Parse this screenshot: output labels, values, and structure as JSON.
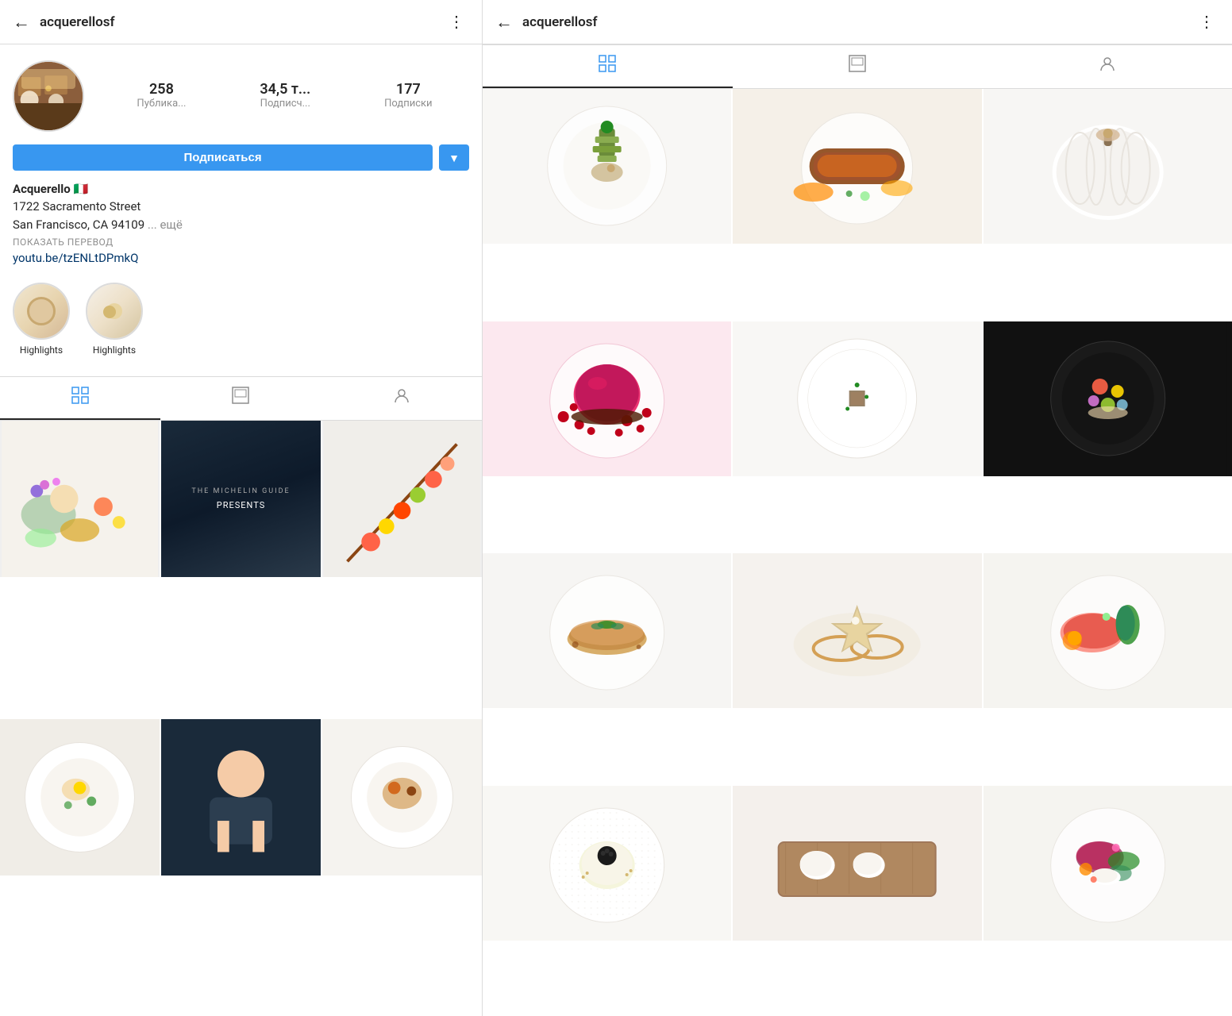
{
  "left": {
    "header": {
      "back_label": "←",
      "username": "acquerellosf",
      "more_label": "⋮"
    },
    "profile": {
      "stats": [
        {
          "number": "258",
          "label": "Публика..."
        },
        {
          "number": "34,5 т...",
          "label": "Подписч..."
        },
        {
          "number": "177",
          "label": "Подписки"
        }
      ],
      "subscribe_btn": "Подписаться",
      "dropdown_btn": "▼",
      "name": "Acquerello 🇮🇹",
      "address_line1": "1722 Sacramento Street",
      "address_line2": "San Francisco, CA 94109",
      "address_more": "... ещё",
      "translate_label": "ПОКАЗАТЬ ПЕРЕВОД",
      "link": "youtu.be/tzENLtDPmkQ",
      "highlights": [
        {
          "label": "Highlights"
        },
        {
          "label": "Highlights"
        }
      ]
    },
    "tabs": [
      {
        "icon": "⊞",
        "label": "grid",
        "active": true
      },
      {
        "icon": "⬜",
        "label": "feed",
        "active": false
      },
      {
        "icon": "☺",
        "label": "tagged",
        "active": false
      }
    ],
    "grid_posts": [
      {
        "bg": "food-1"
      },
      {
        "bg": "michelin-dark",
        "text": "THE MICHELIN GUIDE PRESENTS"
      },
      {
        "bg": "food-3"
      },
      {
        "bg": "food-4"
      },
      {
        "bg": "food-5"
      }
    ]
  },
  "right": {
    "header": {
      "back_label": "←",
      "username": "acquerellosf",
      "more_label": "⋮"
    },
    "tabs": [
      {
        "icon": "⊞",
        "label": "grid",
        "active": true
      },
      {
        "icon": "⬜",
        "label": "feed",
        "active": false
      },
      {
        "icon": "☺",
        "label": "tagged",
        "active": false
      }
    ],
    "grid_rows": [
      [
        {
          "bg": "rfood-1",
          "type": "green-garnish"
        },
        {
          "bg": "rfood-2",
          "type": "meat"
        },
        {
          "bg": "rfood-3",
          "type": "white-pumpkin"
        }
      ],
      [
        {
          "bg": "dessert-plate",
          "type": "dessert"
        },
        {
          "bg": "rfood-5",
          "type": "plain-plate"
        },
        {
          "bg": "rfood-6",
          "type": "dark-plate"
        }
      ],
      [
        {
          "bg": "rfood-7",
          "type": "crepe"
        },
        {
          "bg": "rfood-8",
          "type": "star-dessert"
        },
        {
          "bg": "rfood-9",
          "type": "salmon"
        }
      ],
      [
        {
          "bg": "rfood-10",
          "type": "egg-plate"
        },
        {
          "bg": "rfood-11",
          "type": "wood-plate"
        },
        {
          "bg": "rfood-12",
          "type": "colorful"
        }
      ]
    ]
  }
}
